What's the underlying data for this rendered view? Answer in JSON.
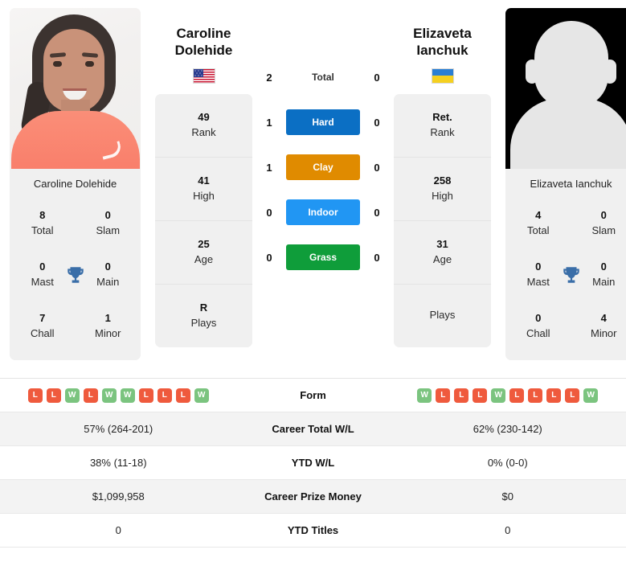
{
  "players": {
    "left": {
      "first_name": "Caroline",
      "last_name": "Dolehide",
      "full_name": "Caroline Dolehide",
      "country": "United States",
      "flag": "us-flag-icon",
      "photo": "player-photo",
      "titles": {
        "total_value": "8",
        "total_label": "Total",
        "slam_value": "0",
        "slam_label": "Slam",
        "mast_value": "0",
        "mast_label": "Mast",
        "main_value": "0",
        "main_label": "Main",
        "chall_value": "7",
        "chall_label": "Chall",
        "minor_value": "1",
        "minor_label": "Minor"
      },
      "info": [
        {
          "value": "49",
          "label": "Rank"
        },
        {
          "value": "41",
          "label": "High"
        },
        {
          "value": "25",
          "label": "Age"
        },
        {
          "value": "R",
          "label": "Plays"
        }
      ],
      "form": [
        "L",
        "L",
        "W",
        "L",
        "W",
        "W",
        "L",
        "L",
        "L",
        "W"
      ],
      "career_total_wl": "57% (264-201)",
      "ytd_wl": "38% (11-18)",
      "career_prize_money": "$1,099,958",
      "ytd_titles": "0"
    },
    "right": {
      "first_name": "Elizaveta",
      "last_name": "Ianchuk",
      "full_name": "Elizaveta Ianchuk",
      "country": "Ukraine",
      "flag": "ua-flag-icon",
      "photo": "player-photo-placeholder",
      "titles": {
        "total_value": "4",
        "total_label": "Total",
        "slam_value": "0",
        "slam_label": "Slam",
        "mast_value": "0",
        "mast_label": "Mast",
        "main_value": "0",
        "main_label": "Main",
        "chall_value": "0",
        "chall_label": "Chall",
        "minor_value": "4",
        "minor_label": "Minor"
      },
      "info": [
        {
          "value": "Ret.",
          "label": "Rank"
        },
        {
          "value": "258",
          "label": "High"
        },
        {
          "value": "31",
          "label": "Age"
        },
        {
          "value": "",
          "label": "Plays"
        }
      ],
      "form": [
        "W",
        "L",
        "L",
        "L",
        "W",
        "L",
        "L",
        "L",
        "L",
        "W"
      ],
      "career_total_wl": "62% (230-142)",
      "ytd_wl": "0% (0-0)",
      "career_prize_money": "$0",
      "ytd_titles": "0"
    }
  },
  "head_to_head": [
    {
      "label": "Total",
      "left": "2",
      "right": "0",
      "style": "plain",
      "color": ""
    },
    {
      "label": "Hard",
      "left": "1",
      "right": "0",
      "style": "pill",
      "color": "#0b6fc4"
    },
    {
      "label": "Clay",
      "left": "1",
      "right": "0",
      "style": "pill",
      "color": "#e08b00"
    },
    {
      "label": "Indoor",
      "left": "0",
      "right": "0",
      "style": "pill",
      "color": "#2196f3"
    },
    {
      "label": "Grass",
      "left": "0",
      "right": "0",
      "style": "pill",
      "color": "#0f9d3a"
    }
  ],
  "table_rows": [
    {
      "label": "Form",
      "type": "form"
    },
    {
      "label": "Career Total W/L",
      "type": "text",
      "left": "57% (264-201)",
      "right": "62% (230-142)"
    },
    {
      "label": "YTD W/L",
      "type": "text",
      "left": "38% (11-18)",
      "right": "0% (0-0)"
    },
    {
      "label": "Career Prize Money",
      "type": "text",
      "left": "$1,099,958",
      "right": "$0"
    },
    {
      "label": "YTD Titles",
      "type": "text",
      "left": "0",
      "right": "0"
    }
  ],
  "colors": {
    "hard": "#0b6fc4",
    "clay": "#e08b00",
    "indoor": "#2196f3",
    "grass": "#0f9d3a",
    "win": "#7bc47f",
    "loss": "#ef5a3d",
    "trophy": "#3a6ea8",
    "panel": "#f0f0f0"
  }
}
